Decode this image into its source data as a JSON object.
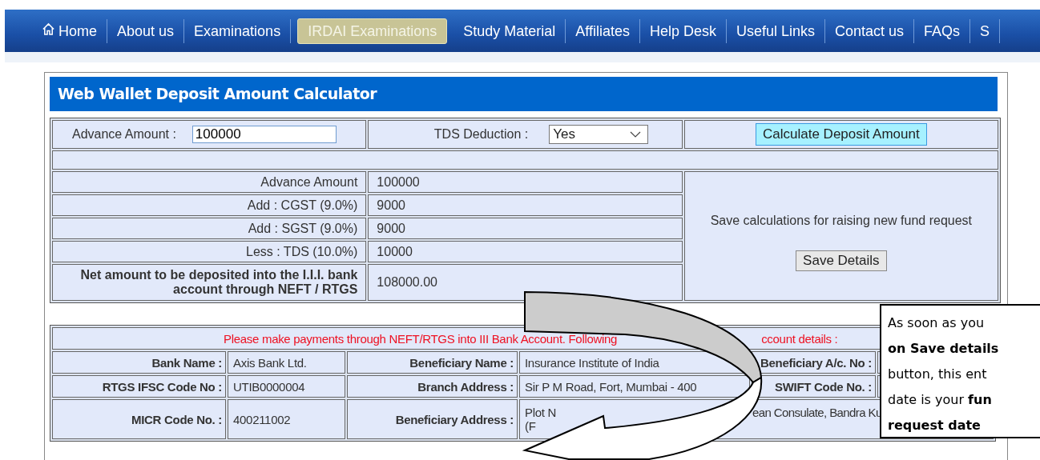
{
  "nav": {
    "items": [
      {
        "label": "Home",
        "selected": false
      },
      {
        "label": "About us",
        "selected": false
      },
      {
        "label": "Examinations",
        "selected": false
      },
      {
        "label": "IRDAI Examinations",
        "selected": true
      },
      {
        "label": "Study Material",
        "selected": false
      },
      {
        "label": "Affiliates",
        "selected": false
      },
      {
        "label": "Help Desk",
        "selected": false
      },
      {
        "label": "Useful Links",
        "selected": false
      },
      {
        "label": "Contact us",
        "selected": false
      },
      {
        "label": "FAQs",
        "selected": false
      },
      {
        "label": "S",
        "selected": false
      }
    ]
  },
  "calculator": {
    "title": "Web Wallet Deposit Amount Calculator",
    "advance_label": "Advance Amount :",
    "advance_value": "100000",
    "tds_label": "TDS Deduction :",
    "tds_value": "Yes",
    "calculate_button": "Calculate Deposit Amount",
    "breakdown": [
      {
        "label": "Advance Amount",
        "value": "100000",
        "emphasis": false
      },
      {
        "label": "Add : CGST (9.0%)",
        "value": "9000",
        "emphasis": false
      },
      {
        "label": "Add : SGST (9.0%)",
        "value": "9000",
        "emphasis": false
      },
      {
        "label": "Less : TDS (10.0%)",
        "value": "10000",
        "emphasis": false
      },
      {
        "label": "Net amount to be deposited into the I.I.I. bank account through NEFT / RTGS",
        "value": "108000.00",
        "emphasis": true
      }
    ],
    "save_note": "Save calculations for raising new fund request",
    "save_button": "Save Details"
  },
  "bank": {
    "notice": [
      "Please make payments through NEFT/RTGS into III Bank Account. Following",
      "ccount details :"
    ],
    "rows": [
      [
        {
          "kind": "label",
          "text": "Bank Name :"
        },
        {
          "kind": "value",
          "text": "Axis Bank Ltd."
        },
        {
          "kind": "label",
          "text": "Beneficiary Name :"
        },
        {
          "kind": "value",
          "text": "Insurance Institute of India"
        },
        {
          "kind": "label",
          "text": "Beneficiary A/c. No :"
        },
        {
          "kind": "empty"
        }
      ],
      [
        {
          "kind": "label",
          "text": "RTGS IFSC Code No :"
        },
        {
          "kind": "value",
          "text": "UTIB0000004"
        },
        {
          "kind": "label",
          "text": "Branch Address :"
        },
        {
          "kind": "value",
          "text": "Sir P M Road, Fort, Mumbai - 400"
        },
        {
          "kind": "label",
          "text": "SWIFT Code No. :"
        },
        {
          "kind": "empty"
        }
      ],
      [
        {
          "kind": "label",
          "text": "MICR Code No. :"
        },
        {
          "kind": "value",
          "text": "400211002"
        },
        {
          "kind": "label",
          "text": "Beneficiary Address :"
        },
        {
          "kind": "split",
          "colspan": 3,
          "parts": [
            "Plot N",
            "ean Consulate, Bandra Ku",
            "(F"
          ]
        }
      ]
    ]
  },
  "callout": {
    "lines": [
      "As soon as you",
      "**on Save details**",
      "button, this ent",
      "date is your **fun**",
      "**request date**"
    ]
  }
}
